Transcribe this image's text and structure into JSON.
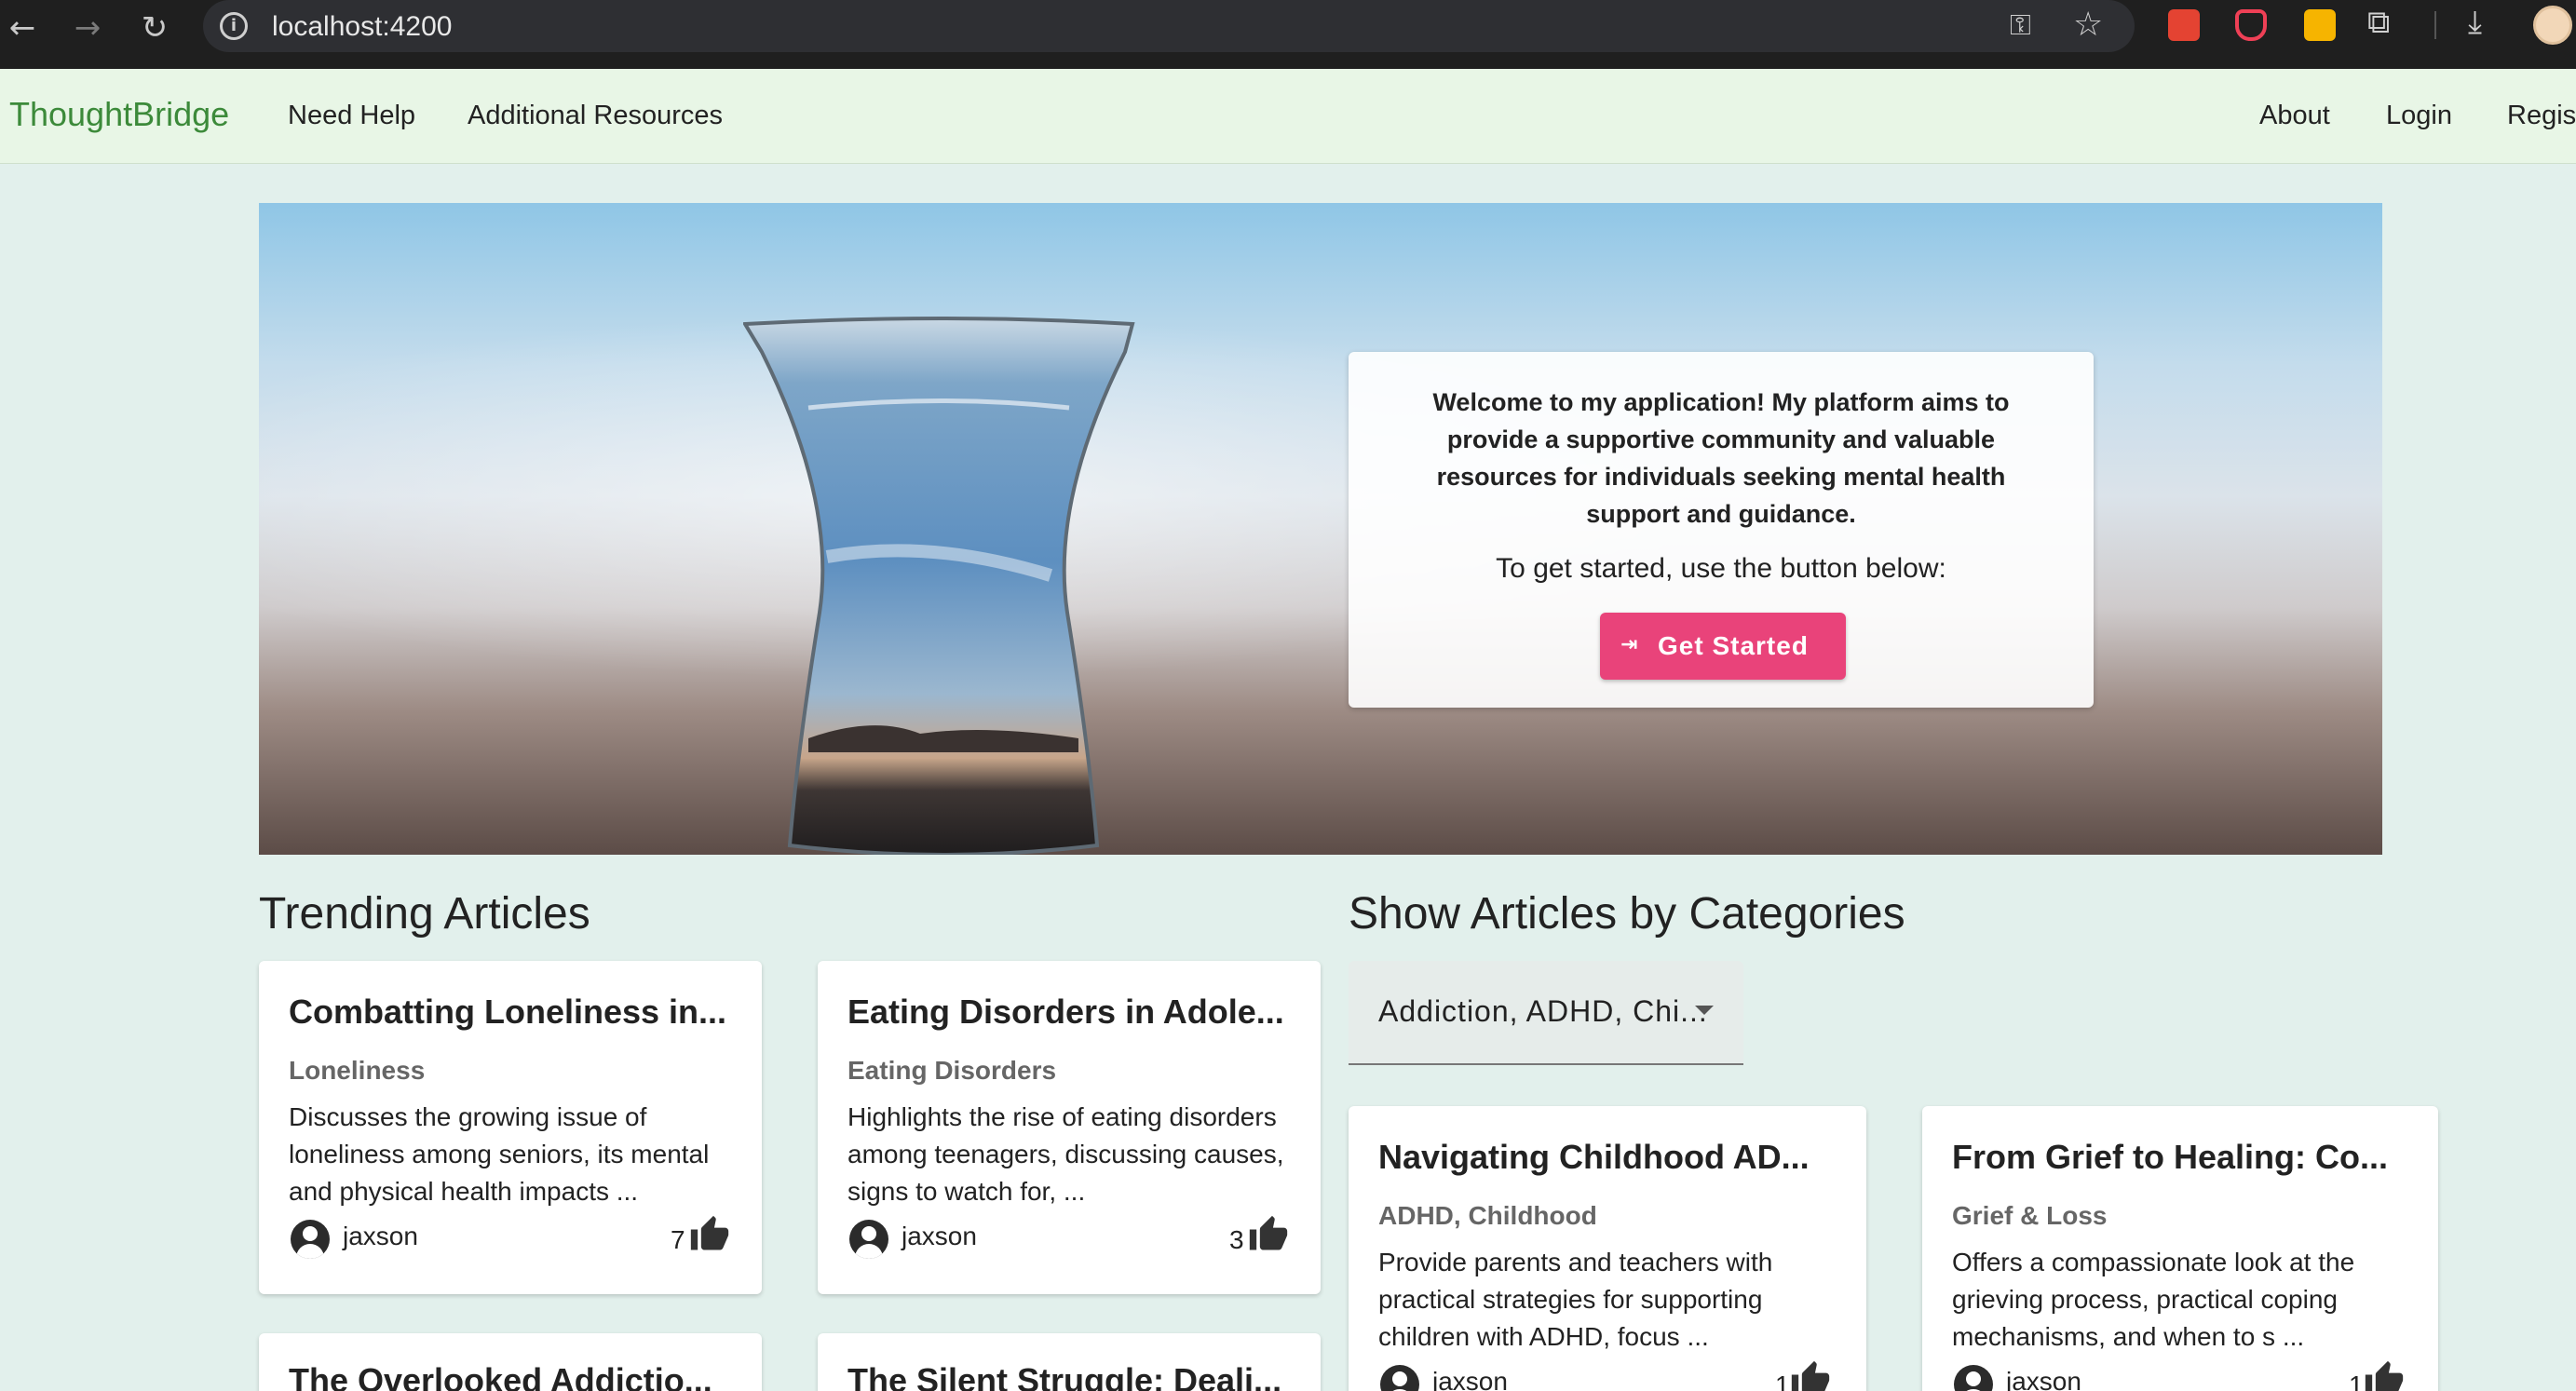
{
  "browser": {
    "url": "localhost:4200",
    "icons": [
      "back-icon",
      "forward-icon",
      "reload-icon",
      "info-icon",
      "key-icon",
      "star-icon",
      "todoist-icon",
      "pocket-icon",
      "keep-icon",
      "extensions-icon",
      "download-icon",
      "profile-avatar"
    ]
  },
  "nav": {
    "brand": "ThoughtBridge",
    "left_links": [
      "Need Help",
      "Additional Resources"
    ],
    "right_links": [
      "About",
      "Login",
      "Register"
    ]
  },
  "hero": {
    "message": "Welcome to my application! My platform aims to provide a supportive community and valuable resources for individuals seeking mental health support and guidance.",
    "subtext": "To get started, use the button below:",
    "button_label": "Get Started",
    "button_color": "#e9437a"
  },
  "trending": {
    "heading": "Trending Articles",
    "articles": [
      {
        "title": "Combatting Loneliness in...",
        "category": "Loneliness",
        "desc": [
          "Discusses the growing issue of",
          "loneliness among seniors, its mental",
          "and physical health impacts ..."
        ],
        "author": "jaxson",
        "likes": "7"
      },
      {
        "title": "Eating Disorders in Adole...",
        "category": "Eating Disorders",
        "desc": [
          "Highlights the rise of eating disorders",
          "among teenagers, discussing causes,",
          "signs to watch for, ..."
        ],
        "author": "jaxson",
        "likes": "3"
      },
      {
        "title": "The Overlooked Addictio...",
        "category": "",
        "desc": [],
        "author": "",
        "likes": ""
      },
      {
        "title": "The Silent Struggle: Deali...",
        "category": "",
        "desc": [],
        "author": "",
        "likes": ""
      }
    ]
  },
  "categories": {
    "heading": "Show Articles by Categories",
    "selected": "Addiction, ADHD, Chi...",
    "articles": [
      {
        "title": "Navigating Childhood AD...",
        "category": "ADHD, Childhood",
        "desc": [
          "Provide parents and teachers with",
          "practical strategies for supporting",
          "children with ADHD, focus ..."
        ],
        "author": "jaxson",
        "likes": "1"
      },
      {
        "title": "From Grief to Healing: Co...",
        "category": "Grief & Loss",
        "desc": [
          "Offers a compassionate look at the",
          "grieving process, practical coping",
          "mechanisms, and when to s ..."
        ],
        "author": "jaxson",
        "likes": "1"
      }
    ]
  },
  "colors": {
    "brand": "#3c8a3a",
    "page_bg": "#e2f0ec",
    "nav_bg": "#e8f6e6"
  }
}
